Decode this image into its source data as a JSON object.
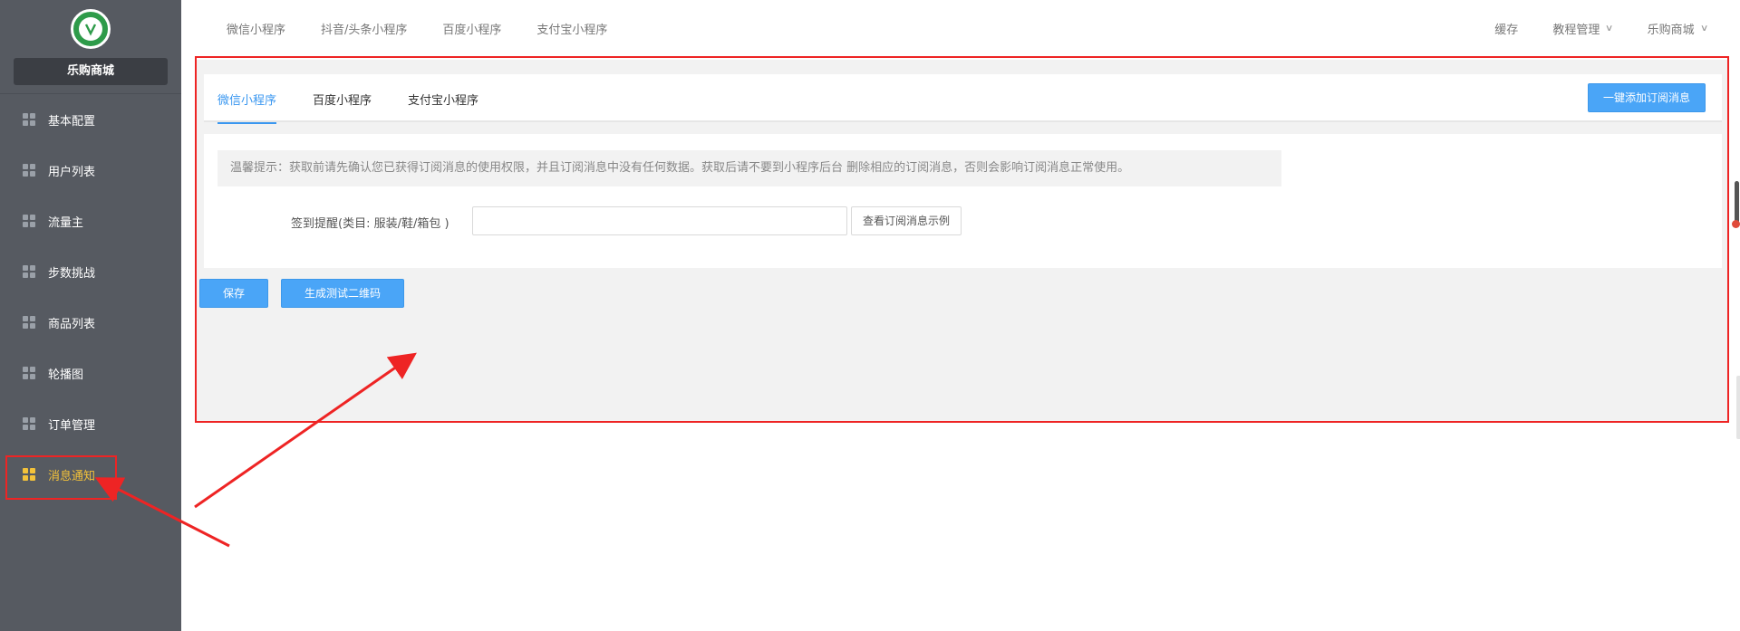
{
  "sidebar": {
    "shop_name": "乐购商城",
    "items": [
      {
        "label": "基本配置",
        "active": false
      },
      {
        "label": "用户列表",
        "active": false
      },
      {
        "label": "流量主",
        "active": false
      },
      {
        "label": "步数挑战",
        "active": false
      },
      {
        "label": "商品列表",
        "active": false
      },
      {
        "label": "轮播图",
        "active": false
      },
      {
        "label": "订单管理",
        "active": false
      },
      {
        "label": "消息通知",
        "active": true
      }
    ],
    "icon": "grid-icon"
  },
  "topbar": {
    "tabs": [
      "微信小程序",
      "抖音/头条小程序",
      "百度小程序",
      "支付宝小程序"
    ],
    "right": {
      "cache": "缓存",
      "tutorial": "教程管理",
      "shop": "乐购商城"
    }
  },
  "main": {
    "tabs": [
      {
        "label": "微信小程序",
        "active": true
      },
      {
        "label": "百度小程序",
        "active": false
      },
      {
        "label": "支付宝小程序",
        "active": false
      }
    ],
    "oneclick_button": "一键添加订阅消息",
    "tip": "温馨提示：获取前请先确认您已获得订阅消息的使用权限，并且订阅消息中没有任何数据。获取后请不要到小程序后台 删除相应的订阅消息，否则会影响订阅消息正常使用。",
    "field": {
      "label": "签到提醒(类目: 服装/鞋/箱包 )",
      "value": "",
      "placeholder": ""
    },
    "example_button": "查看订阅消息示例",
    "save_button": "保存",
    "qr_button": "生成测试二维码"
  },
  "colors": {
    "sidebar_bg": "#565a61",
    "accent": "#4aa5f7",
    "active_menu": "#f3c23a",
    "annotation": "#ee2424"
  }
}
